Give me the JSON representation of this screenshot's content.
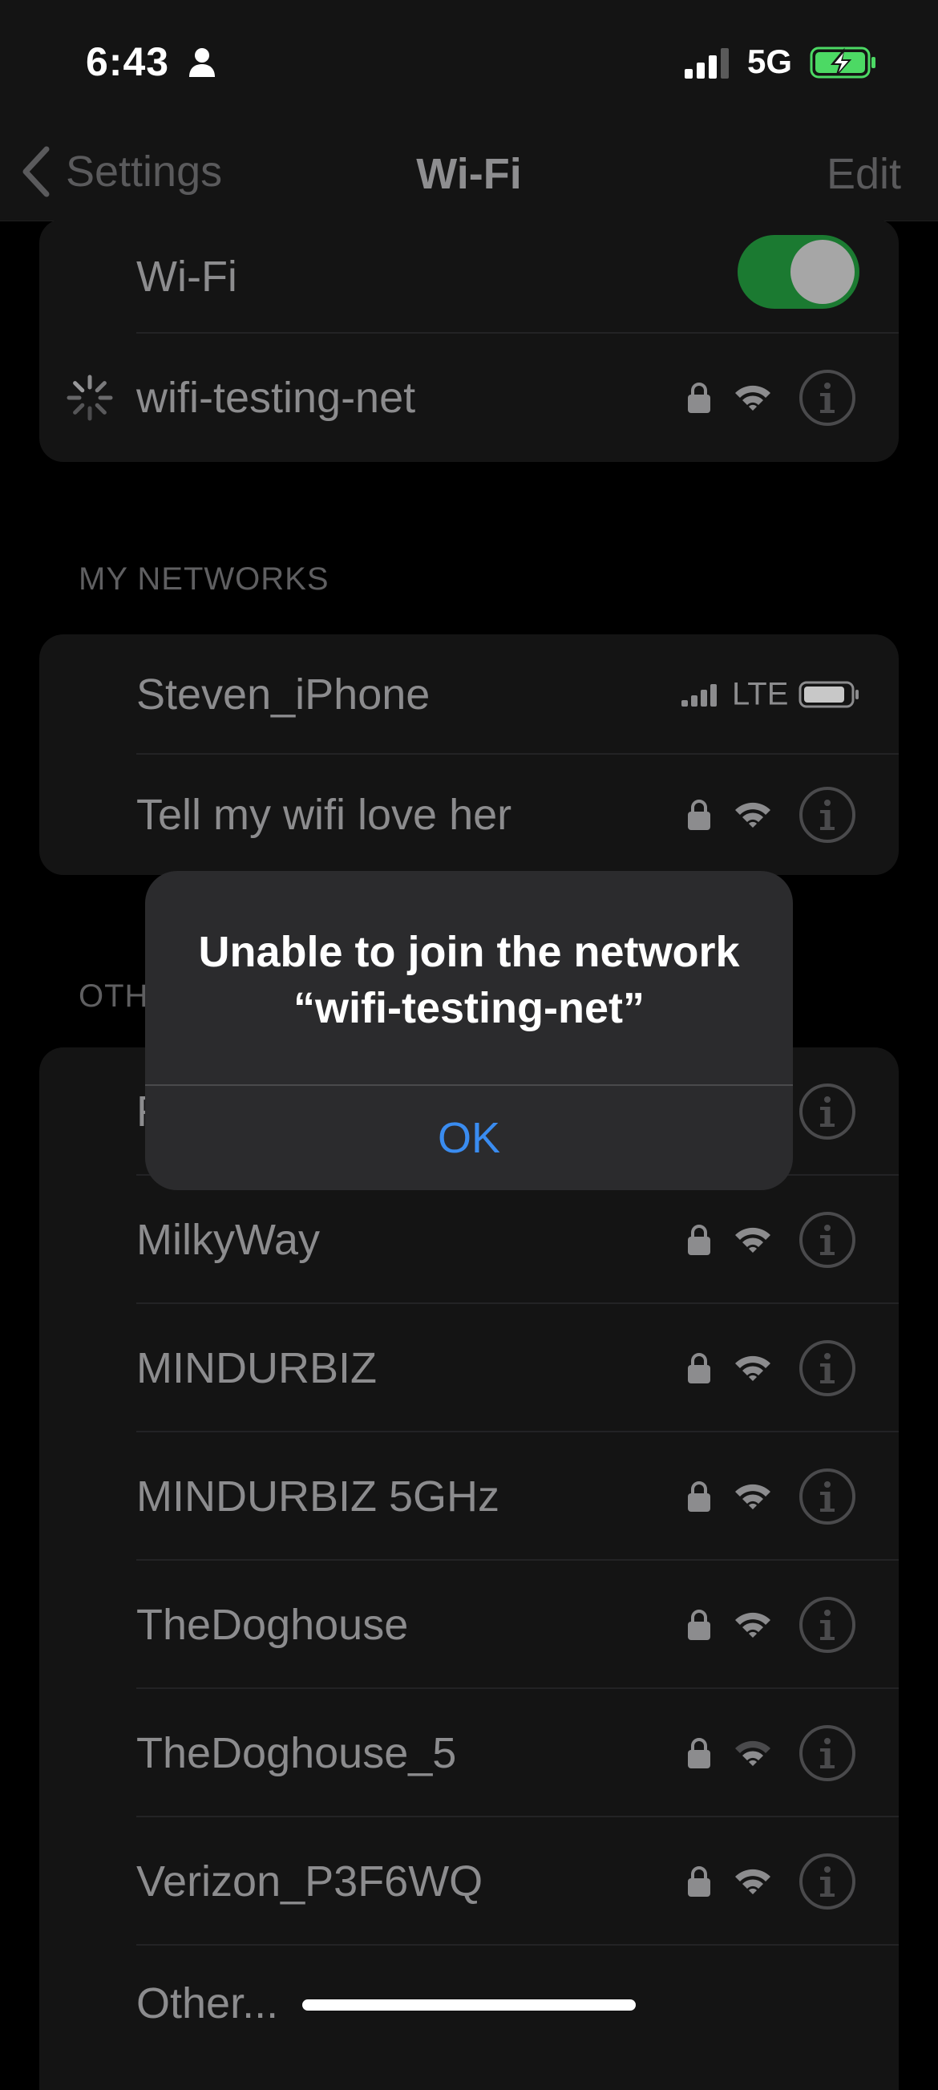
{
  "status_bar": {
    "time": "6:43",
    "network": "5G"
  },
  "nav": {
    "back_label": "Settings",
    "title": "Wi-Fi",
    "edit_label": "Edit"
  },
  "wifi_toggle": {
    "label": "Wi-Fi",
    "on": true
  },
  "connecting_network": {
    "name": "wifi-testing-net"
  },
  "my_networks": {
    "header": "MY NETWORKS",
    "items": [
      {
        "name": "Steven_iPhone",
        "type": "hotspot",
        "cell": "LTE"
      },
      {
        "name": "Tell my wifi love her",
        "type": "wifi"
      }
    ]
  },
  "other_networks": {
    "header": "OTH",
    "first_item_partial": "F",
    "items": [
      {
        "name": "MilkyWay"
      },
      {
        "name": "MINDURBIZ"
      },
      {
        "name": "MINDURBIZ 5GHz"
      },
      {
        "name": "TheDoghouse"
      },
      {
        "name": "TheDoghouse_5"
      },
      {
        "name": "Verizon_P3F6WQ"
      }
    ],
    "other_label": "Other..."
  },
  "alert": {
    "title_line1": "Unable to join the network",
    "title_line2": "“wifi-testing-net”",
    "ok_label": "OK"
  },
  "colors": {
    "toggle_on": "#1b7a31",
    "link_blue": "#3a8cf0",
    "battery_green": "#4cd964"
  },
  "icons": [
    "person-icon",
    "cellular-signal-icon",
    "battery-charging-icon",
    "chevron-left-icon",
    "lock-icon",
    "wifi-icon",
    "info-icon",
    "spinner-icon",
    "hotspot-battery-icon"
  ]
}
